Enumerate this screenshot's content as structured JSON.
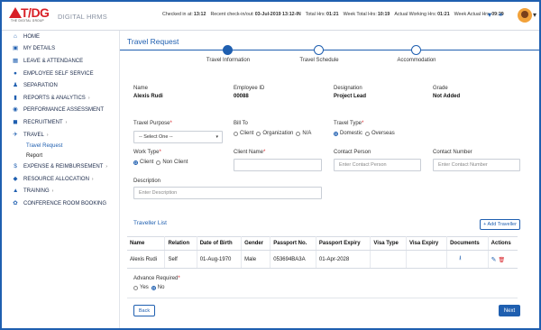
{
  "header": {
    "app_name": "DIGITAL HRMS",
    "logo_text": "T/DG",
    "logo_sub": "THE DIGITAL GROUP",
    "stats": [
      {
        "label": "Checked in at:",
        "value": "13:12"
      },
      {
        "label": "Recent check-in/out:",
        "value": "03-Jul-2019 13:12-IN"
      },
      {
        "label": "Total Hrs:",
        "value": "01:21"
      },
      {
        "label": "Week Total Hrs:",
        "value": "10:19"
      },
      {
        "label": "Actual Working Hrs:",
        "value": "01:21"
      },
      {
        "label": "Week Actual Hrs:",
        "value": "09:29"
      }
    ]
  },
  "sidebar": {
    "items": [
      {
        "label": "HOME",
        "icon": "home-icon",
        "glyph": "⌂"
      },
      {
        "label": "MY DETAILS",
        "icon": "id-card-icon",
        "glyph": "▣"
      },
      {
        "label": "LEAVE & ATTENDANCE",
        "icon": "calendar-icon",
        "glyph": "▦"
      },
      {
        "label": "EMPLOYEE SELF SERVICE",
        "icon": "person-icon",
        "glyph": "●"
      },
      {
        "label": "SEPARATION",
        "icon": "exit-person-icon",
        "glyph": "♟"
      },
      {
        "label": "REPORTS & ANALYTICS",
        "icon": "chart-icon",
        "glyph": "▮",
        "chevron": true
      },
      {
        "label": "PERFORMANCE ASSESSMENT",
        "icon": "users-icon",
        "glyph": "◉"
      },
      {
        "label": "RECRUITMENT",
        "icon": "briefcase-icon",
        "glyph": "◼",
        "chevron": true
      },
      {
        "label": "TRAVEL",
        "icon": "plane-icon",
        "glyph": "✈",
        "chevron": true
      }
    ],
    "travel_sub": [
      "Travel Request",
      "Report"
    ],
    "items_after": [
      {
        "label": "EXPENSE & REIMBURSEMENT",
        "icon": "money-icon",
        "glyph": "$",
        "chevron": true
      },
      {
        "label": "RESOURCE ALLOCATION",
        "icon": "resource-icon",
        "glyph": "◆",
        "chevron": true
      },
      {
        "label": "TRAINING",
        "icon": "training-icon",
        "glyph": "▲",
        "chevron": true
      },
      {
        "label": "CONFERENCE ROOM BOOKING",
        "icon": "conference-icon",
        "glyph": "✿"
      }
    ]
  },
  "page": {
    "title": "Travel Request",
    "steps": [
      "Travel Information",
      "Travel Schedule",
      "Accommodation"
    ]
  },
  "employee": {
    "name_label": "Name",
    "name": "Alexis Rudi",
    "id_label": "Employee ID",
    "id": "00088",
    "designation_label": "Designation",
    "designation": "Project Lead",
    "grade_label": "Grade",
    "grade": "Not Added"
  },
  "form": {
    "purpose_label": "Travel Purpose",
    "purpose_value": "-- Select One --",
    "bill_to_label": "Bill To",
    "bill_to_options": [
      "Client",
      "Organization",
      "N/A"
    ],
    "travel_type_label": "Travel Type",
    "travel_type_options": [
      "Domestic",
      "Overseas"
    ],
    "work_type_label": "Work Type",
    "work_type_options": [
      "Client",
      "Non Client"
    ],
    "client_name_label": "Client Name",
    "contact_person_label": "Contact Person",
    "contact_person_placeholder": "Enter Contact Person",
    "contact_number_label": "Contact Number",
    "contact_number_placeholder": "Enter Contact Number",
    "description_label": "Description",
    "description_placeholder": "Enter Description"
  },
  "traveller_list": {
    "title": "Traveller List",
    "add_label": "+ Add Traveller",
    "columns": [
      "Name",
      "Relation",
      "Date of Birth",
      "Gender",
      "Passport No.",
      "Passport Expiry",
      "Visa Type",
      "Visa Expiry",
      "Documents",
      "Actions"
    ],
    "rows": [
      [
        "Alexis Rudi",
        "Self",
        "01-Aug-1970",
        "Male",
        "053694BA3A",
        "01-Apr-2028",
        "",
        "",
        "",
        ""
      ]
    ]
  },
  "advance": {
    "label": "Advance Required",
    "options": [
      "Yes",
      "No"
    ]
  },
  "buttons": {
    "back": "Back",
    "next": "Next"
  },
  "colors": {
    "accent": "#1f5fb0",
    "brand_red": "#d81f26"
  }
}
